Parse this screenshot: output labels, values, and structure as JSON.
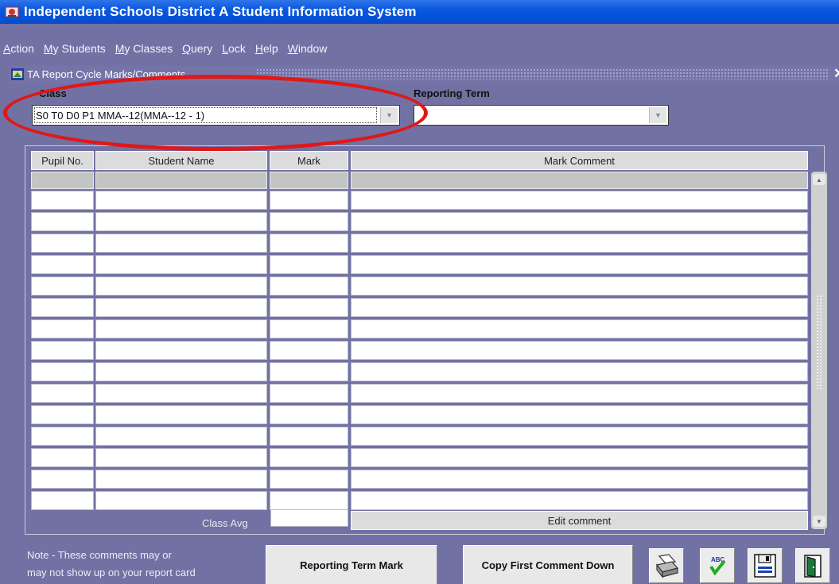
{
  "app": {
    "title": "Independent Schools District A Student Information System"
  },
  "menu": {
    "items": [
      "Action",
      "My Students",
      "My Classes",
      "Query",
      "Lock",
      "Help",
      "Window"
    ]
  },
  "inner_window": {
    "title": "TA Report Cycle Marks/Comments",
    "close_glyph": "✕"
  },
  "form": {
    "class_label": "Class",
    "class_value": "S0 T0 D0 P1 MMA--12(MMA--12 - 1)",
    "reporting_term_label": "Reporting Term",
    "reporting_term_value": ""
  },
  "table": {
    "headers": [
      "Pupil No.",
      "Student Name",
      "Mark",
      "Mark Comment"
    ],
    "row_count": 15
  },
  "footer": {
    "class_avg_label": "Class Avg",
    "class_avg_value": "",
    "edit_comment_label": "Edit comment",
    "note_line1": "Note -  These comments may or",
    "note_line2": "may not show up on your report card",
    "reporting_term_mark_button": "Reporting Term Mark",
    "copy_first_comment_button": "Copy First Comment Down"
  },
  "icons": {
    "print": "print-icon",
    "spellcheck": "spellcheck-icon",
    "save": "save-icon",
    "exit": "exit-door-icon"
  },
  "colors": {
    "window_bg": "#7171a4",
    "titlebar": "#0a58e0",
    "highlight": "#e01818"
  }
}
